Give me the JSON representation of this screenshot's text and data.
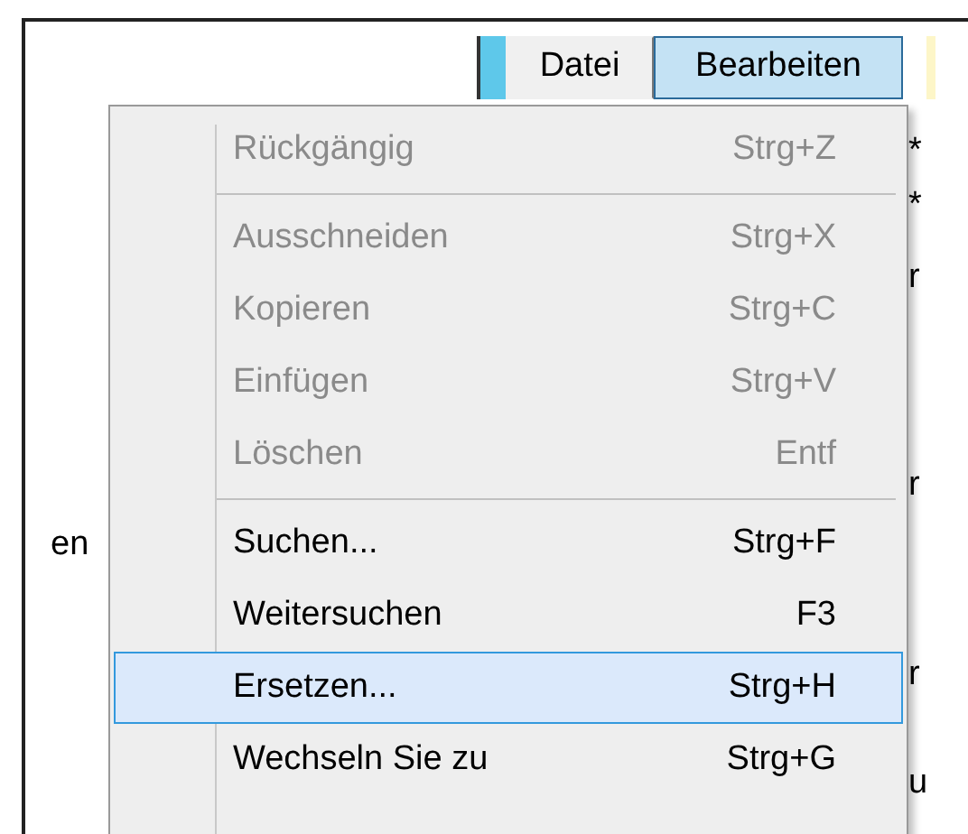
{
  "menu_bar": [
    {
      "label": "Datei",
      "selected": false
    },
    {
      "label": "Bearbeiten",
      "selected": true
    }
  ],
  "background_text": {
    "left": "en",
    "right": [
      "*",
      "*",
      "r",
      "r",
      "r",
      "u"
    ]
  },
  "dropdown": [
    {
      "kind": "item",
      "label": "Rückgängig",
      "shortcut": "Strg+Z",
      "disabled": true,
      "selected": false
    },
    {
      "kind": "separator"
    },
    {
      "kind": "item",
      "label": "Ausschneiden",
      "shortcut": "Strg+X",
      "disabled": true,
      "selected": false
    },
    {
      "kind": "item",
      "label": "Kopieren",
      "shortcut": "Strg+C",
      "disabled": true,
      "selected": false
    },
    {
      "kind": "item",
      "label": "Einfügen",
      "shortcut": "Strg+V",
      "disabled": true,
      "selected": false
    },
    {
      "kind": "item",
      "label": "Löschen",
      "shortcut": "Entf",
      "disabled": true,
      "selected": false
    },
    {
      "kind": "separator"
    },
    {
      "kind": "item",
      "label": "Suchen...",
      "shortcut": "Strg+F",
      "disabled": false,
      "selected": false
    },
    {
      "kind": "item",
      "label": "Weitersuchen",
      "shortcut": "F3",
      "disabled": false,
      "selected": false
    },
    {
      "kind": "item",
      "label": "Ersetzen...",
      "shortcut": "Strg+H",
      "disabled": false,
      "selected": true
    },
    {
      "kind": "item",
      "label": "Wechseln Sie zu",
      "shortcut": "Strg+G",
      "disabled": false,
      "selected": false
    }
  ]
}
